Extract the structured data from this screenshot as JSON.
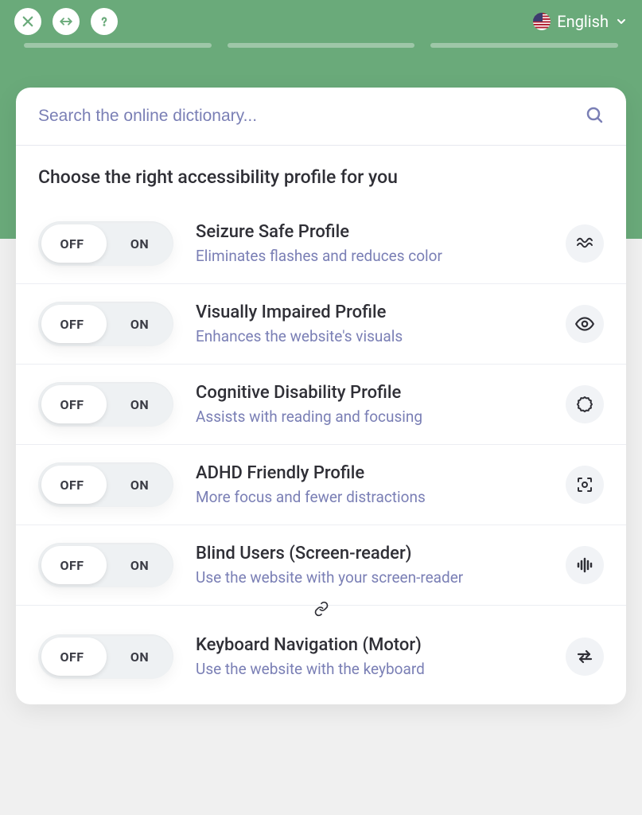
{
  "header": {
    "language_label": "English"
  },
  "search": {
    "placeholder": "Search the online dictionary..."
  },
  "section_title": "Choose the right accessibility profile for you",
  "toggle": {
    "off": "OFF",
    "on": "ON"
  },
  "profiles": [
    {
      "title": "Seizure Safe Profile",
      "desc": "Eliminates flashes and reduces color"
    },
    {
      "title": "Visually Impaired Profile",
      "desc": "Enhances the website's visuals"
    },
    {
      "title": "Cognitive Disability Profile",
      "desc": "Assists with reading and focusing"
    },
    {
      "title": "ADHD Friendly Profile",
      "desc": "More focus and fewer distractions"
    },
    {
      "title": "Blind Users (Screen-reader)",
      "desc": "Use the website with your screen-reader"
    },
    {
      "title": "Keyboard Navigation (Motor)",
      "desc": "Use the website with the keyboard"
    }
  ]
}
